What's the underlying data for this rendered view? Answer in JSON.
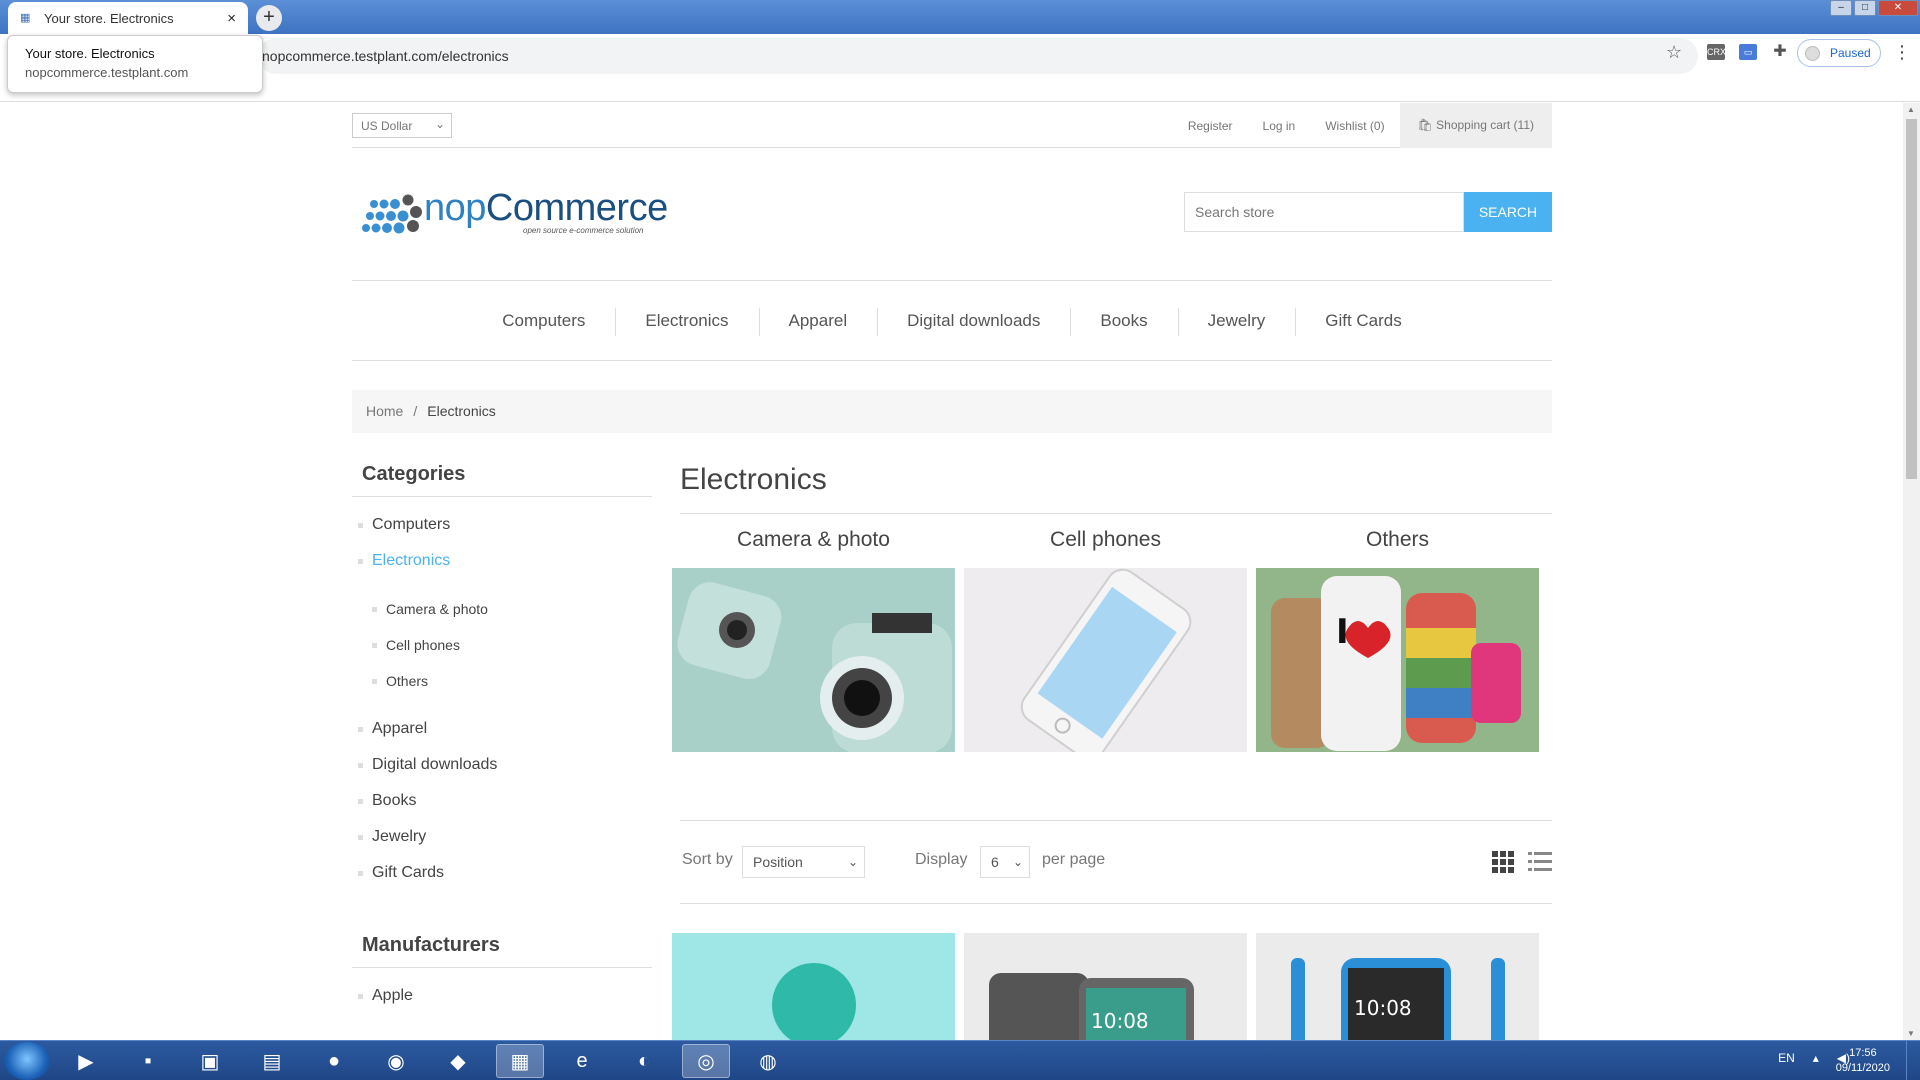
{
  "browser": {
    "tab_title": "Your store. Electronics",
    "tab_close": "×",
    "new_tab": "+",
    "url": "nopcommerce.testplant.com/electronics",
    "tooltip_title": "Your store. Electronics",
    "tooltip_url": "nopcommerce.testplant.com",
    "profile_label": "Paused",
    "ext1": "CRX",
    "ext2": "▭",
    "window_buttons": [
      "–",
      "□",
      "✕"
    ]
  },
  "header": {
    "currency": "US Dollar",
    "links": {
      "register": "Register",
      "login": "Log in",
      "wishlist": "Wishlist (0)",
      "cart": "Shopping cart (11)"
    },
    "logo_text_a": "nop",
    "logo_text_b": "Commerce",
    "logo_sub": "open source e-commerce solution",
    "search_placeholder": "Search store",
    "search_button": "Search"
  },
  "menu": [
    "Computers",
    "Electronics",
    "Apparel",
    "Digital downloads",
    "Books",
    "Jewelry",
    "Gift Cards"
  ],
  "breadcrumb": {
    "home": "Home",
    "sep": "/",
    "current": "Electronics"
  },
  "sidebar": {
    "categories_title": "Categories",
    "categories": [
      "Computers",
      "Electronics",
      "Camera & photo",
      "Cell phones",
      "Others",
      "Apparel",
      "Digital downloads",
      "Books",
      "Jewelry",
      "Gift Cards"
    ],
    "manufacturers_title": "Manufacturers",
    "manufacturers": [
      "Apple"
    ]
  },
  "main": {
    "title": "Electronics",
    "subcategories": [
      "Camera & photo",
      "Cell phones",
      "Others"
    ],
    "sort_label": "Sort by",
    "sort_value": "Position",
    "display_label": "Display",
    "display_value": "6",
    "per_page": "per page",
    "product_times": [
      "10:08",
      "10:08"
    ]
  },
  "taskbar": {
    "language": "EN",
    "time": "17:56",
    "date": "09/11/2020"
  }
}
